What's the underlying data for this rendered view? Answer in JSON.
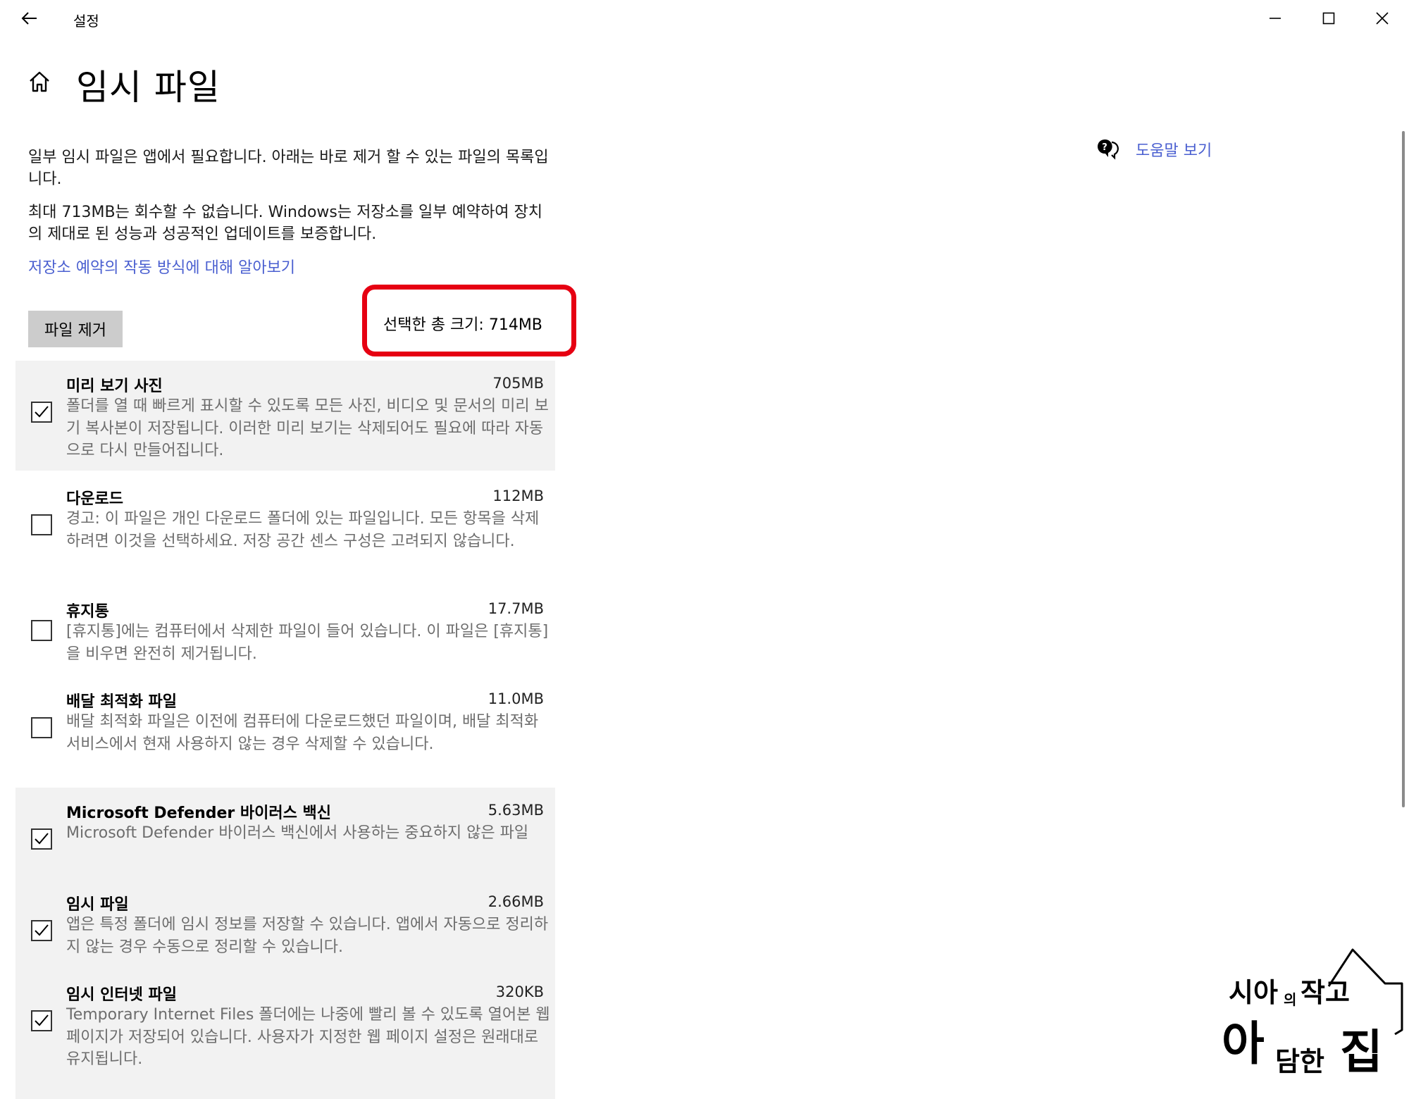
{
  "window": {
    "title": "설정",
    "controls": [
      "minimize-icon",
      "maximize-icon",
      "close-icon"
    ]
  },
  "header": {
    "title": "임시 파일"
  },
  "description": {
    "line1": "일부 임시 파일은 앱에서 필요합니다. 아래는 바로 제거 할 수 있는 파일의 목록입니다.",
    "line2": "최대 713MB는 회수할 수 없습니다. Windows는 저장소를 일부 예약하여 장치의 제대로 된 성능과 성공적인 업데이트를 보증합니다.",
    "link": "저장소 예약의 작동 방식에 대해 알아보기"
  },
  "actions": {
    "remove_label": "파일 제거",
    "total_label": "선택한 총 크기: 714MB"
  },
  "items": [
    {
      "title": "미리 보기 사진",
      "size": "705MB",
      "checked": true,
      "desc": "폴더를 열 때 빠르게 표시할 수 있도록 모든 사진, 비디오 및 문서의 미리 보기 복사본이 저장됩니다. 이러한 미리 보기는 삭제되어도 필요에 따라 자동으로 다시 만들어집니다."
    },
    {
      "title": "다운로드",
      "size": "112MB",
      "checked": false,
      "desc": "경고: 이 파일은 개인 다운로드 폴더에 있는 파일입니다. 모든 항목을 삭제하려면 이것을 선택하세요. 저장 공간 센스 구성은 고려되지 않습니다."
    },
    {
      "title": "휴지통",
      "size": "17.7MB",
      "checked": false,
      "desc": "[휴지통]에는 컴퓨터에서 삭제한 파일이 들어 있습니다. 이 파일은 [휴지통]을 비우면 완전히 제거됩니다."
    },
    {
      "title": "배달 최적화 파일",
      "size": "11.0MB",
      "checked": false,
      "desc": "배달 최적화 파일은 이전에 컴퓨터에 다운로드했던 파일이며, 배달 최적화 서비스에서 현재 사용하지 않는 경우 삭제할 수 있습니다."
    },
    {
      "title": "Microsoft Defender 바이러스 백신",
      "size": "5.63MB",
      "checked": true,
      "desc": "Microsoft Defender 바이러스 백신에서 사용하는 중요하지 않은 파일"
    },
    {
      "title": "임시 파일",
      "size": "2.66MB",
      "checked": true,
      "desc": "앱은 특정 폴더에 임시 정보를 저장할 수 있습니다. 앱에서 자동으로 정리하지 않는 경우 수동으로 정리할 수 있습니다."
    },
    {
      "title": "임시 인터넷 파일",
      "size": "320KB",
      "checked": true,
      "desc": "Temporary Internet Files 폴더에는 나중에 빨리 볼 수 있도록 열어본 웹 페이지가 저장되어 있습니다. 사용자가 지정한 웹 페이지 설정은 원래대로 유지됩니다."
    }
  ],
  "help": {
    "label": "도움말 보기",
    "icon": "help-chat-icon"
  },
  "watermark": {
    "line1": "시아의 작고",
    "line2": "아담한 집"
  }
}
